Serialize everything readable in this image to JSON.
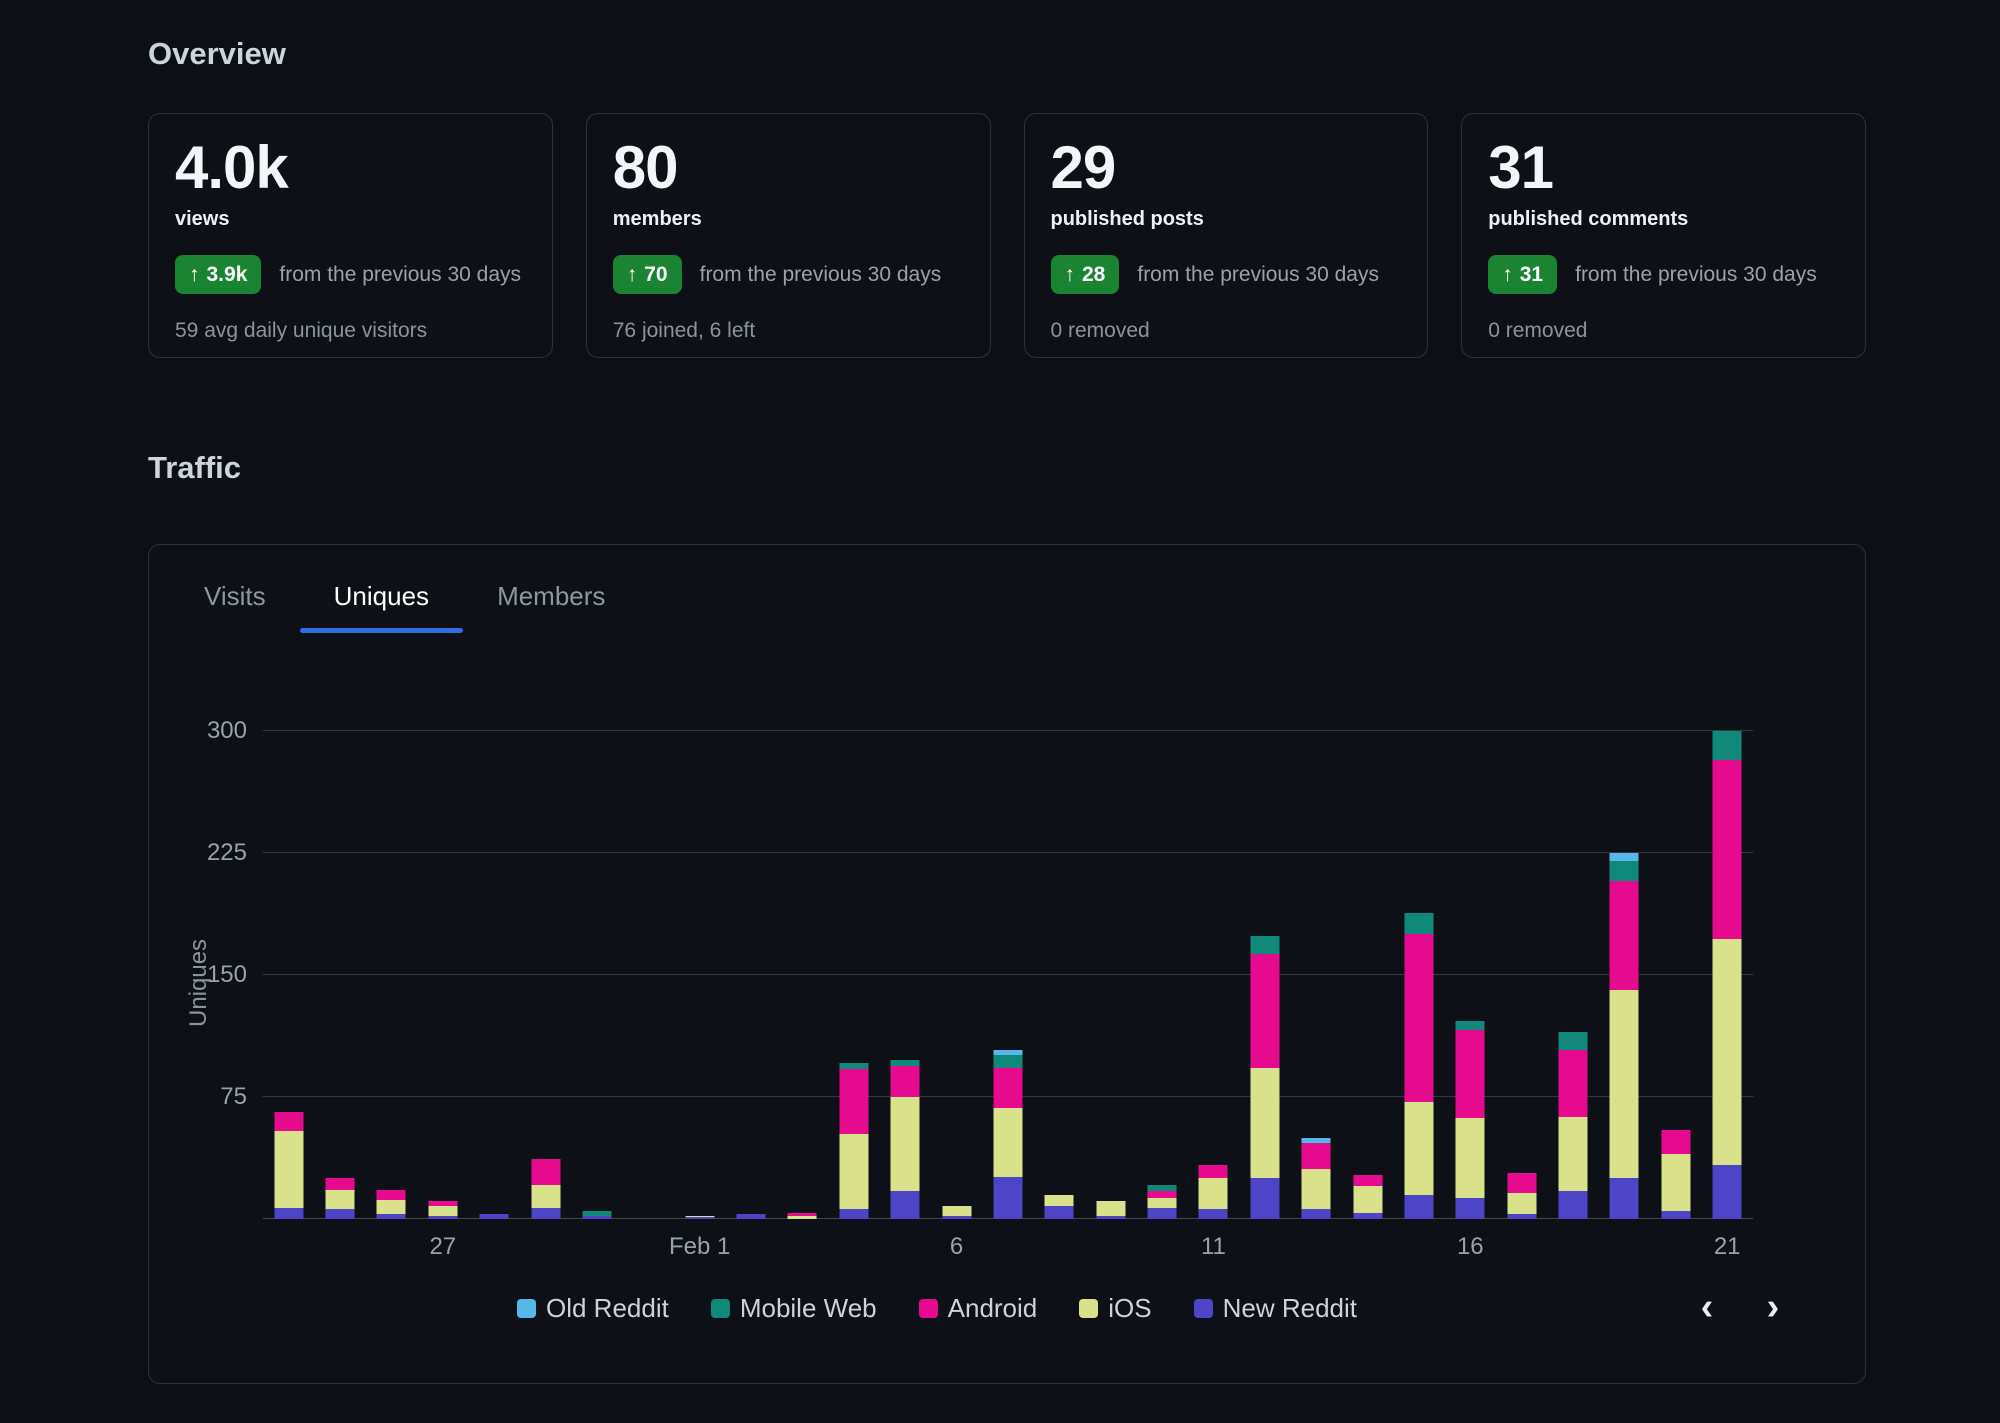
{
  "overview": {
    "title": "Overview",
    "cards": [
      {
        "value": "4.0k",
        "label": "views",
        "badge_value": "3.9k",
        "badge_caption": "from the previous 30 days",
        "footnote": "59 avg daily unique visitors"
      },
      {
        "value": "80",
        "label": "members",
        "badge_value": "70",
        "badge_caption": "from the previous 30 days",
        "footnote": "76 joined, 6 left"
      },
      {
        "value": "29",
        "label": "published posts",
        "badge_value": "28",
        "badge_caption": "from the previous 30 days",
        "footnote": "0 removed"
      },
      {
        "value": "31",
        "label": "published comments",
        "badge_value": "31",
        "badge_caption": "from the previous 30 days",
        "footnote": "0 removed"
      }
    ]
  },
  "traffic": {
    "title": "Traffic",
    "tabs": [
      {
        "label": "Visits",
        "active": false
      },
      {
        "label": "Uniques",
        "active": true
      },
      {
        "label": "Members",
        "active": false
      }
    ],
    "nav": {
      "prev": "‹",
      "next": "›"
    }
  },
  "glyphs": {
    "arrow_up": "↑"
  },
  "chart_data": {
    "type": "bar",
    "stacked": true,
    "title": "",
    "xlabel": "",
    "ylabel": "Uniques",
    "ylim": [
      0,
      300
    ],
    "yticks": [
      75,
      150,
      225,
      300
    ],
    "grid": true,
    "legend_position": "bottom",
    "categories": [
      "Jan 24",
      "Jan 25",
      "Jan 26",
      "Jan 27",
      "Jan 28",
      "Jan 29",
      "Jan 30",
      "Jan 31",
      "Feb 1",
      "Feb 2",
      "Feb 3",
      "Feb 4",
      "Feb 5",
      "Feb 6",
      "Feb 7",
      "Feb 8",
      "Feb 9",
      "Feb 10",
      "Feb 11",
      "Feb 12",
      "Feb 13",
      "Feb 14",
      "Feb 15",
      "Feb 16",
      "Feb 17",
      "Feb 18",
      "Feb 19",
      "Feb 20",
      "Feb 21"
    ],
    "xtick_labels": [
      "",
      "",
      "",
      "27",
      "",
      "",
      "",
      "",
      "Feb 1",
      "",
      "",
      "",
      "",
      "6",
      "",
      "",
      "",
      "",
      "11",
      "",
      "",
      "",
      "",
      "16",
      "",
      "",
      "",
      "",
      "21"
    ],
    "legend": [
      "Old Reddit",
      "Mobile Web",
      "Android",
      "iOS",
      "New Reddit"
    ],
    "colors": {
      "Old Reddit": "#56b8e9",
      "Mobile Web": "#10897b",
      "Android": "#e50a8e",
      "iOS": "#d9e18a",
      "New Reddit": "#4d45c6"
    },
    "stack_bottom_to_top": [
      "New Reddit",
      "iOS",
      "Android",
      "Mobile Web",
      "Old Reddit"
    ],
    "series": [
      {
        "name": "Old Reddit",
        "values": [
          0,
          0,
          0,
          0,
          0,
          0,
          0,
          0,
          0,
          0,
          0,
          0,
          0,
          0,
          3,
          0,
          0,
          0,
          0,
          0,
          3,
          0,
          0,
          0,
          0,
          0,
          5,
          0,
          0
        ]
      },
      {
        "name": "Mobile Web",
        "values": [
          0,
          0,
          0,
          0,
          0,
          0,
          3,
          0,
          0,
          0,
          0,
          4,
          4,
          0,
          8,
          0,
          0,
          4,
          0,
          11,
          0,
          0,
          13,
          6,
          0,
          11,
          12,
          0,
          18
        ]
      },
      {
        "name": "Android",
        "values": [
          12,
          7,
          6,
          3,
          0,
          16,
          0,
          0,
          0,
          0,
          2,
          40,
          19,
          0,
          25,
          0,
          0,
          4,
          8,
          70,
          16,
          7,
          103,
          54,
          12,
          41,
          67,
          15,
          110
        ]
      },
      {
        "name": "iOS",
        "values": [
          47,
          12,
          9,
          6,
          0,
          14,
          0,
          0,
          1,
          0,
          2,
          46,
          58,
          6,
          42,
          7,
          9,
          6,
          19,
          68,
          25,
          16,
          57,
          49,
          13,
          46,
          116,
          35,
          139
        ]
      },
      {
        "name": "New Reddit",
        "values": [
          7,
          6,
          3,
          2,
          3,
          7,
          2,
          0,
          1,
          3,
          0,
          6,
          17,
          2,
          26,
          8,
          2,
          7,
          6,
          25,
          6,
          4,
          15,
          13,
          3,
          17,
          25,
          5,
          33
        ]
      }
    ]
  }
}
